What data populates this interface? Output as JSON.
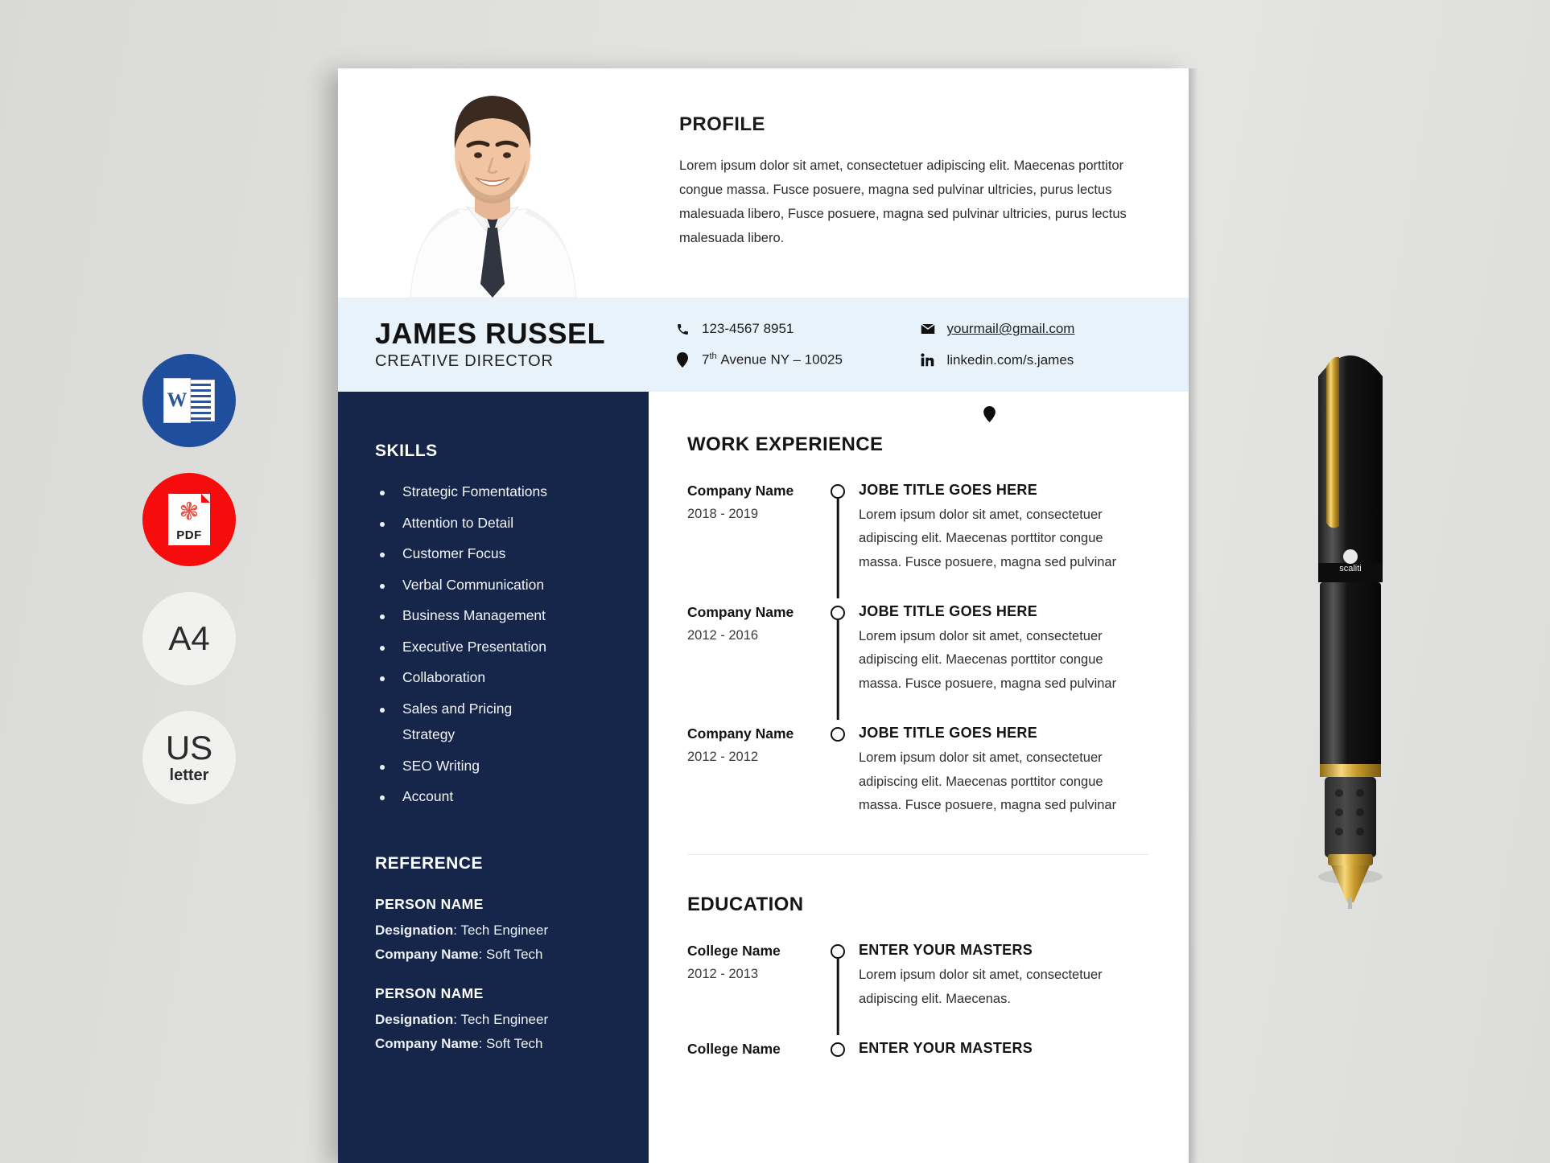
{
  "formats": [
    {
      "name": "word-format-badge",
      "kind": "word",
      "label": "W"
    },
    {
      "name": "pdf-format-badge",
      "kind": "pdf",
      "label": "PDF"
    },
    {
      "name": "a4-format-badge",
      "kind": "plain",
      "big": "A4",
      "small": ""
    },
    {
      "name": "usletter-format-badge",
      "kind": "plain",
      "big": "US",
      "small": "letter"
    }
  ],
  "resume": {
    "profile": {
      "heading": "PROFILE",
      "body": "Lorem ipsum dolor sit amet, consectetuer adipiscing elit. Maecenas porttitor congue massa. Fusce posuere, magna sed pulvinar ultricies, purus lectus malesuada libero, Fusce posuere, magna sed pulvinar ultricies, purus lectus malesuada libero."
    },
    "identity": {
      "name": "JAMES RUSSEL",
      "role": "CREATIVE DIRECTOR"
    },
    "contacts": [
      {
        "icon": "phone-icon",
        "text": "123-4567 8951",
        "style": "plain"
      },
      {
        "icon": "envelope-icon",
        "text": "yourmail@gmail.com",
        "style": "underline"
      },
      {
        "icon": "location-pin-icon",
        "text": "7th Avenue NY – 10025",
        "style": "superscript-th"
      },
      {
        "icon": "linkedin-icon",
        "text": "linkedin.com/s.james",
        "style": "plain"
      }
    ],
    "skills": {
      "heading": "SKILLS",
      "items": [
        {
          "text": "Strategic Fomentations",
          "bullet": true
        },
        {
          "text": "Attention to Detail",
          "bullet": true
        },
        {
          "text": "Customer Focus",
          "bullet": true
        },
        {
          "text": "Verbal Communication",
          "bullet": true
        },
        {
          "text": "Business Management",
          "bullet": true
        },
        {
          "text": "Executive Presentation",
          "bullet": true
        },
        {
          "text": "Collaboration",
          "bullet": true
        },
        {
          "text": "Sales and Pricing",
          "bullet": true
        },
        {
          "text": "Strategy",
          "bullet": false
        },
        {
          "text": "SEO Writing",
          "bullet": true
        },
        {
          "text": "Account",
          "bullet": true
        }
      ]
    },
    "reference": {
      "heading": "REFERENCE",
      "entries": [
        {
          "person": "PERSON NAME",
          "designation_label": "Designation",
          "designation_value": "Tech Engineer",
          "company_label": "Company Name",
          "company_value": "Soft Tech"
        },
        {
          "person": "PERSON NAME",
          "designation_label": "Designation",
          "designation_value": "Tech Engineer",
          "company_label": "Company Name",
          "company_value": "Soft Tech"
        }
      ]
    },
    "work": {
      "heading": "WORK EXPERIENCE",
      "entries": [
        {
          "org": "Company Name",
          "years": "2018 - 2019",
          "title": "JOBE TITLE GOES HERE",
          "desc": "Lorem ipsum dolor sit amet, consectetuer adipiscing elit. Maecenas porttitor congue massa. Fusce posuere, magna sed pulvinar"
        },
        {
          "org": "Company Name",
          "years": "2012 - 2016",
          "title": "JOBE TITLE GOES HERE",
          "desc": "Lorem ipsum dolor sit amet, consectetuer adipiscing elit. Maecenas porttitor congue massa. Fusce posuere, magna sed pulvinar"
        },
        {
          "org": "Company Name",
          "years": "2012 - 2012",
          "title": "JOBE TITLE GOES HERE",
          "desc": "Lorem ipsum dolor sit amet, consectetuer adipiscing elit. Maecenas porttitor congue massa. Fusce posuere, magna sed pulvinar"
        }
      ]
    },
    "education": {
      "heading": "EDUCATION",
      "entries": [
        {
          "org": "College Name",
          "years": "2012 - 2013",
          "title": "ENTER YOUR MASTERS",
          "desc": "Lorem ipsum dolor sit amet, consectetuer adipiscing elit. Maecenas."
        },
        {
          "org": "College Name",
          "years": "",
          "title": "ENTER YOUR MASTERS",
          "desc": ""
        }
      ]
    }
  },
  "colors": {
    "navy": "#15264a",
    "light_blue_band": "#e8f2fb",
    "word_blue": "#1f4e9c",
    "pdf_red": "#f60c0c",
    "canvas": "#dfdfdd"
  }
}
